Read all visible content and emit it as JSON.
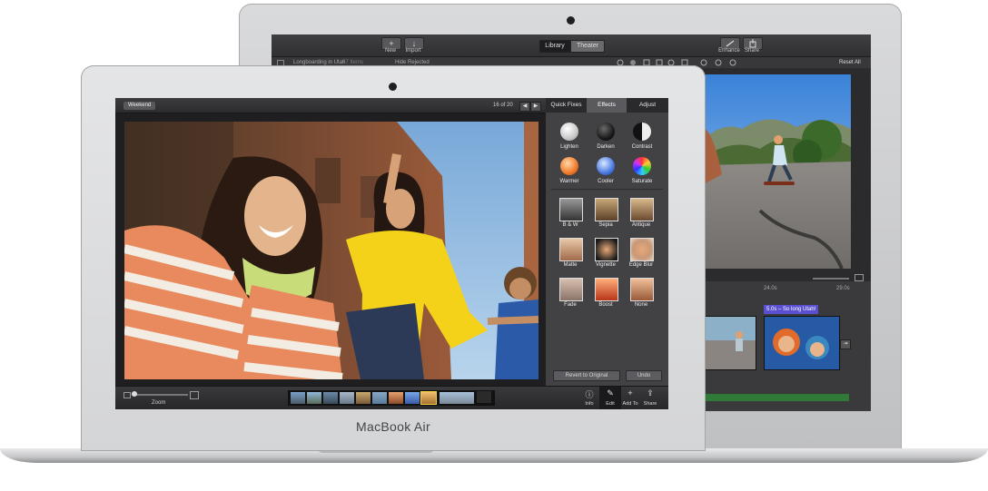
{
  "back": {
    "toolbar": {
      "new_label": "New",
      "import_label": "Import",
      "library_tab": "Library",
      "theater_tab": "Theater",
      "enhance_label": "Enhance",
      "share_label": "Share",
      "reset_label": "Reset All",
      "new_glyph": "+",
      "import_glyph": "↓"
    },
    "bar": {
      "project": "Longboarding in Utah",
      "count": "27 Items",
      "filter": "Hide Rejected"
    },
    "timeline": {
      "tick1": "24.0s",
      "tick2": "29.0s",
      "title_chip": "5.0s – So long Utah!"
    }
  },
  "front": {
    "brand": "MacBook Air",
    "top": {
      "album": "Weekend",
      "counter": "16 of 20"
    },
    "tabs": [
      {
        "label": "Quick Fixes"
      },
      {
        "label": "Effects"
      },
      {
        "label": "Adjust"
      }
    ],
    "orbs": [
      {
        "label": "Lighten"
      },
      {
        "label": "Darken"
      },
      {
        "label": "Contrast"
      },
      {
        "label": "Warmer"
      },
      {
        "label": "Cooler"
      },
      {
        "label": "Saturate"
      }
    ],
    "effects": [
      {
        "label": "B & W"
      },
      {
        "label": "Sepia"
      },
      {
        "label": "Antique"
      },
      {
        "label": "Matte"
      },
      {
        "label": "Vignette"
      },
      {
        "label": "Edge Blur"
      },
      {
        "label": "Fade"
      },
      {
        "label": "Boost"
      },
      {
        "label": "None"
      }
    ],
    "revert_label": "Revert to Original",
    "undo_label": "Undo",
    "zoom_label": "Zoom",
    "bottom": [
      {
        "label": "Info"
      },
      {
        "label": "Edit"
      },
      {
        "label": "Add To"
      },
      {
        "label": "Share"
      }
    ]
  }
}
